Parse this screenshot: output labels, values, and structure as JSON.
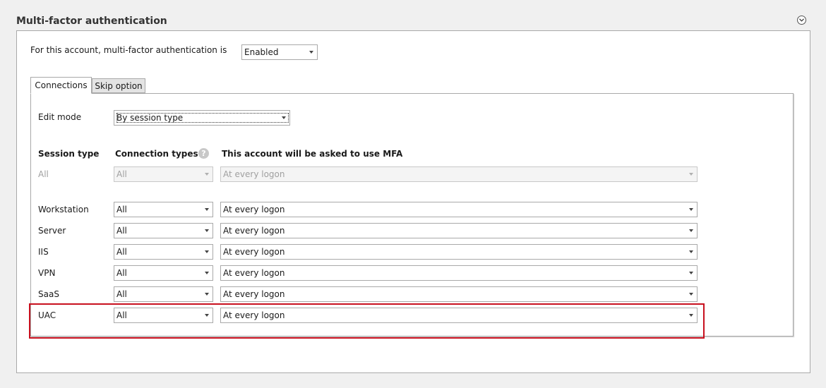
{
  "section": {
    "title": "Multi-factor authentication"
  },
  "account_status": {
    "label": "For this account, multi-factor authentication is",
    "value": "Enabled"
  },
  "tabs": [
    {
      "label": "Connections"
    },
    {
      "label": "Skip option"
    }
  ],
  "edit_mode": {
    "label": "Edit mode",
    "value": "By session type"
  },
  "columns": {
    "session_type": "Session type",
    "connection_types": "Connection types",
    "mfa": "This account will be asked to use MFA"
  },
  "all_row": {
    "session": "All",
    "connection": "All",
    "mfa": "At every logon"
  },
  "rows": [
    {
      "session": "Workstation",
      "connection": "All",
      "mfa": "At every logon"
    },
    {
      "session": "Server",
      "connection": "All",
      "mfa": "At every logon"
    },
    {
      "session": "IIS",
      "connection": "All",
      "mfa": "At every logon"
    },
    {
      "session": "VPN",
      "connection": "All",
      "mfa": "At every logon"
    },
    {
      "session": "SaaS",
      "connection": "All",
      "mfa": "At every logon"
    },
    {
      "session": "UAC",
      "connection": "All",
      "mfa": "At every logon"
    }
  ],
  "colors": {
    "highlight": "#c8101e",
    "border": "#a9a9a9"
  }
}
